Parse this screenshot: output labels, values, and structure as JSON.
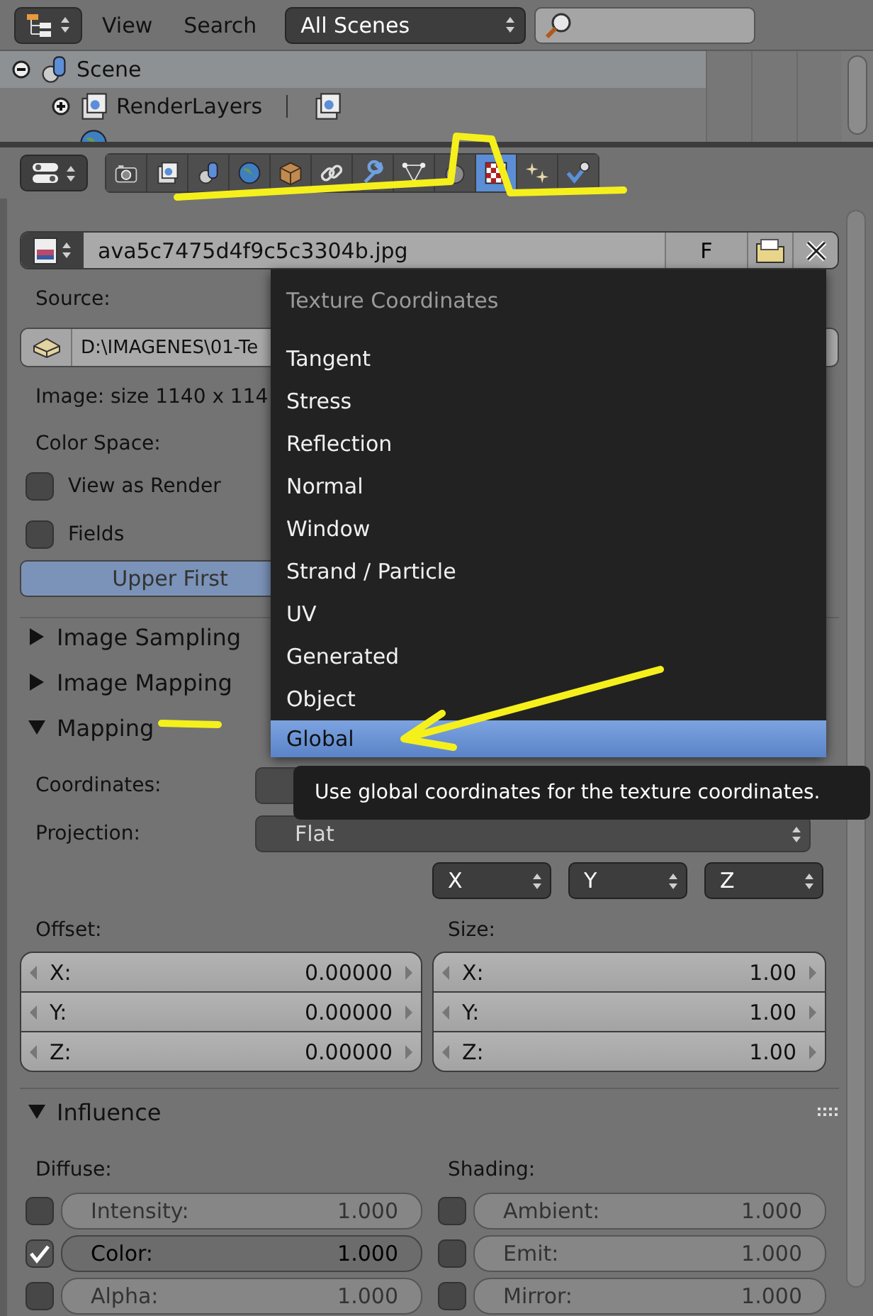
{
  "outliner_header": {
    "view_menu": "View",
    "search_menu": "Search",
    "scene_filter": "All Scenes"
  },
  "outliner": {
    "items": [
      {
        "label": "Scene",
        "selected": true,
        "expanded": true,
        "children": [
          {
            "label": "RenderLayers",
            "selected": false,
            "expanded": false
          },
          {
            "selected": false
          }
        ]
      }
    ]
  },
  "properties_tabs": [
    {
      "selected": false
    },
    {
      "selected": false
    },
    {
      "selected": false
    },
    {
      "selected": false
    },
    {
      "selected": false
    },
    {
      "selected": false
    },
    {
      "selected": false
    },
    {
      "selected": false
    },
    {
      "selected": false
    },
    {
      "selected": true
    },
    {
      "selected": false
    },
    {
      "selected": false
    }
  ],
  "image": {
    "name": "ava5c7475d4f9c5c3304b.jpg",
    "fake_user": "F",
    "source_label": "Source:",
    "filepath": "D:\\IMAGENES\\01-Te",
    "info": "Image: size 1140 x 114",
    "color_space_label": "Color Space:",
    "options": [
      {
        "label": "View as Render",
        "checked": false
      },
      {
        "label": "Fields",
        "checked": false
      }
    ],
    "field_order": [
      {
        "label": "Upper First",
        "selected": true
      }
    ]
  },
  "panels": [
    {
      "title": "Image Sampling",
      "expanded": false
    },
    {
      "title": "Image Mapping",
      "expanded": false
    },
    {
      "title": "Mapping",
      "expanded": true
    }
  ],
  "mapping": {
    "coordinates_label": "Coordinates:",
    "projection_label": "Projection:",
    "projection_value": "Flat",
    "axes": [
      "X",
      "Y",
      "Z"
    ],
    "offset": {
      "label": "Offset:",
      "fields": [
        {
          "axis": "X:",
          "value": "0.00000"
        },
        {
          "axis": "Y:",
          "value": "0.00000"
        },
        {
          "axis": "Z:",
          "value": "0.00000"
        }
      ]
    },
    "size": {
      "label": "Size:",
      "fields": [
        {
          "axis": "X:",
          "value": "1.00"
        },
        {
          "axis": "Y:",
          "value": "1.00"
        },
        {
          "axis": "Z:",
          "value": "1.00"
        }
      ]
    }
  },
  "influence": {
    "title": "Influence",
    "expanded": true,
    "diffuse_label": "Diffuse:",
    "shading_label": "Shading:",
    "diffuse": [
      {
        "label": "Intensity:",
        "value": "1.000",
        "checked": false
      },
      {
        "label": "Color:",
        "value": "1.000",
        "checked": true
      },
      {
        "label": "Alpha:",
        "value": "1.000",
        "checked": false
      }
    ],
    "shading": [
      {
        "label": "Ambient:",
        "value": "1.000",
        "checked": false
      },
      {
        "label": "Emit:",
        "value": "1.000",
        "checked": false
      },
      {
        "label": "Mirror:",
        "value": "1.000",
        "checked": false
      }
    ]
  },
  "popup": {
    "title": "Texture Coordinates",
    "items": [
      {
        "label": "Tangent",
        "selected": false
      },
      {
        "label": "Stress",
        "selected": false
      },
      {
        "label": "Reflection",
        "selected": false
      },
      {
        "label": "Normal",
        "selected": false
      },
      {
        "label": "Window",
        "selected": false
      },
      {
        "label": "Strand / Particle",
        "selected": false
      },
      {
        "label": "UV",
        "selected": false
      },
      {
        "label": "Generated",
        "selected": false
      },
      {
        "label": "Object",
        "selected": false
      },
      {
        "label": "Global",
        "selected": true
      }
    ]
  },
  "tooltip": {
    "text": "Use global coordinates for the texture coordinates."
  }
}
